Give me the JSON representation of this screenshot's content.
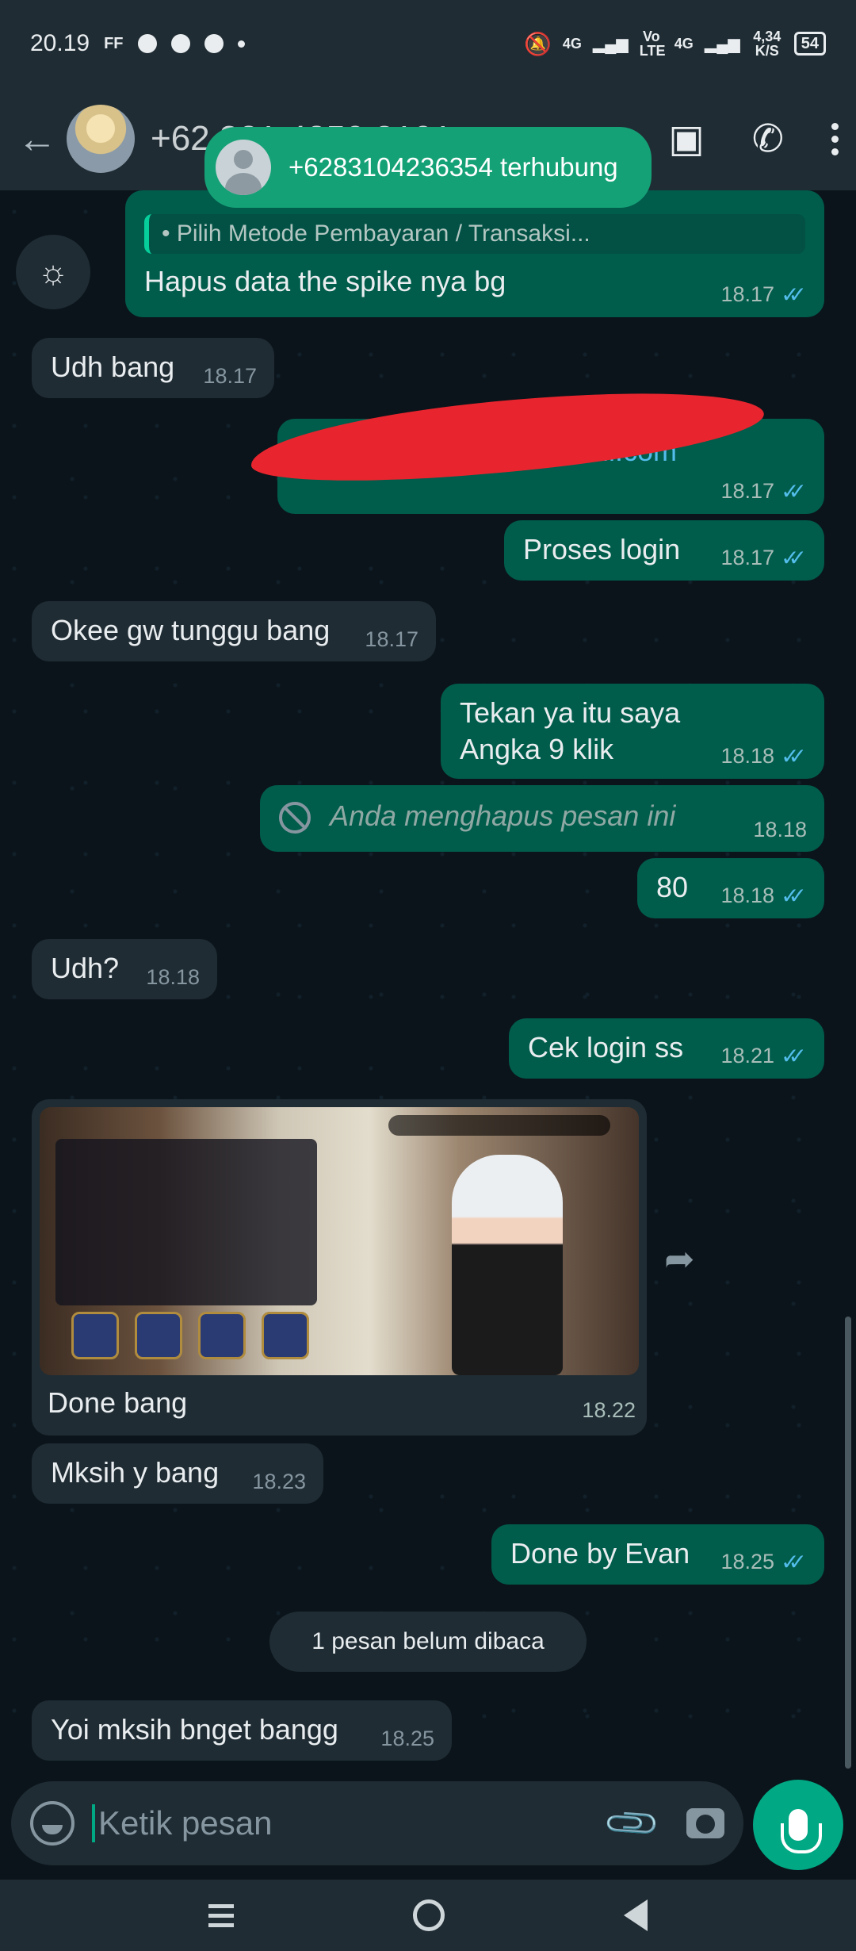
{
  "status_bar": {
    "time": "20.19",
    "ff_label": "FF",
    "net_1": "4G",
    "volte": "Vo LTE",
    "net_2": "4G",
    "speed": "4,34 K/S",
    "battery": "54"
  },
  "header": {
    "contact_name": "+62 821 4250 8101",
    "toast_text": "+6283104236354  terhubung"
  },
  "messages": [
    {
      "dir": "out",
      "quote": "• Pilih Metode Pembayaran / Transaksi...",
      "text": "Hapus data the spike nya bg",
      "time": "18.17"
    },
    {
      "dir": "in",
      "text": "Udh bang",
      "time": "18.17"
    },
    {
      "dir": "out",
      "text": "mail.com",
      "time": "18.17"
    },
    {
      "dir": "out",
      "text": "Proses login",
      "time": "18.17"
    },
    {
      "dir": "in",
      "text": "Okee gw tunggu bang",
      "time": "18.17"
    },
    {
      "dir": "out",
      "text": "Tekan ya itu saya\nAngka 9 klik",
      "time": "18.18"
    },
    {
      "dir": "out",
      "text": "Anda menghapus pesan ini",
      "time": "18.18"
    },
    {
      "dir": "out",
      "text": "80",
      "time": "18.18"
    },
    {
      "dir": "in",
      "text": "Udh?",
      "time": "18.18"
    },
    {
      "dir": "out",
      "text": "Cek login ss",
      "time": "18.21"
    },
    {
      "dir": "in",
      "text": "Done bang",
      "time": "18.22"
    },
    {
      "dir": "in",
      "text": "Mksih y bang",
      "time": "18.23"
    },
    {
      "dir": "out",
      "text": "Done by Evan",
      "time": "18.25"
    },
    {
      "dir": "in",
      "text": "Yoi mksih bnget bangg",
      "time": "18.25"
    }
  ],
  "unread": "1 pesan belum dibaca",
  "input": {
    "placeholder": "Ketik pesan"
  },
  "colors": {
    "outgoing": "#005c4b",
    "incoming": "#1f2c34",
    "accent": "#00a884",
    "ticks": "#53bdeb"
  },
  "icons": [
    "back-arrow-icon",
    "video-call-icon",
    "phone-icon",
    "more-icon",
    "emoji-icon",
    "attach-icon",
    "camera-icon",
    "mic-icon",
    "share-icon",
    "deleted-icon"
  ]
}
